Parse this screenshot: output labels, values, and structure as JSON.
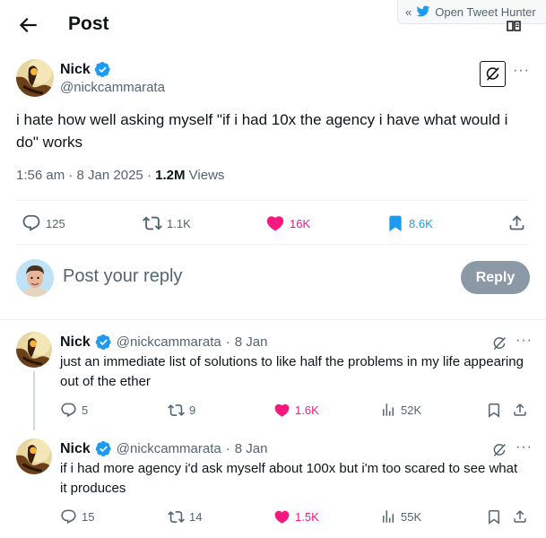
{
  "header": {
    "title": "Post",
    "extension_label": "Open Tweet Hunter",
    "extension_chevron": "«"
  },
  "main_post": {
    "author_name": "Nick",
    "author_handle": "@nickcammarata",
    "text": "i hate how well asking myself \"if i had 10x the agency i have what would i do\" works",
    "time": "1:56 am",
    "date": "8 Jan 2025",
    "views_count": "1.2M",
    "views_label": "Views",
    "separator": "·",
    "actions": {
      "replies": "125",
      "reposts": "1.1K",
      "likes": "16K",
      "bookmarks": "8.6K"
    }
  },
  "compose": {
    "placeholder": "Post your reply",
    "button_label": "Reply"
  },
  "replies": [
    {
      "author_name": "Nick",
      "author_handle": "@nickcammarata",
      "separator": "·",
      "date": "8 Jan",
      "text": "just an immediate list of solutions to like half the problems in my life appearing out of the ether",
      "replies": "5",
      "reposts": "9",
      "likes": "1.6K",
      "views": "52K"
    },
    {
      "author_name": "Nick",
      "author_handle": "@nickcammarata",
      "separator": "·",
      "date": "8 Jan",
      "text": "if i had more agency i'd ask myself about 100x but i'm too scared to see what it produces",
      "replies": "15",
      "reposts": "14",
      "likes": "1.5K",
      "views": "55K"
    }
  ],
  "colors": {
    "accent": "#1d9bf0",
    "like": "#f91880",
    "muted": "#536471",
    "button_disabled": "#8b98a5"
  },
  "icons": [
    "back-arrow-icon",
    "verified-badge-icon",
    "grok-icon",
    "more-icon",
    "reply-icon",
    "repost-icon",
    "like-icon",
    "bookmark-icon",
    "share-icon",
    "views-icon",
    "bird-icon",
    "book-icon"
  ]
}
